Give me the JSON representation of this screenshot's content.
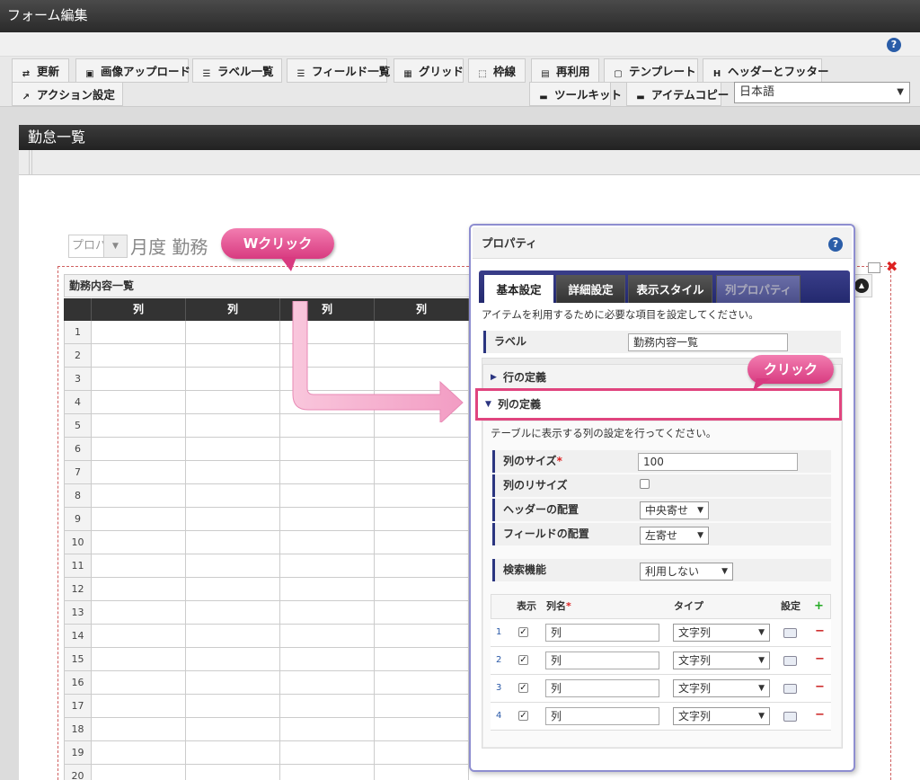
{
  "window": {
    "title": "フォーム編集"
  },
  "help_label": "?",
  "toolbar": {
    "row1": [
      {
        "label": "更新",
        "icon": "refresh-icon"
      },
      {
        "label": "画像アップロード",
        "icon": "image-upload-icon"
      },
      {
        "label": "ラベル一覧",
        "icon": "label-list-icon"
      },
      {
        "label": "フィールド一覧",
        "icon": "field-list-icon"
      },
      {
        "label": "グリッド",
        "icon": "grid-icon"
      },
      {
        "label": "枠線",
        "icon": "border-icon"
      },
      {
        "label": "再利用",
        "icon": "reuse-icon"
      },
      {
        "label": "テンプレート",
        "icon": "template-icon"
      },
      {
        "label": "ヘッダーとフッター",
        "icon": "header-footer-icon"
      }
    ],
    "row2": [
      {
        "label": "アクション設定",
        "icon": "action-icon"
      },
      {
        "label": "ツールキット",
        "icon": "toolkit-icon"
      },
      {
        "label": "アイテムコピー",
        "icon": "item-copy-icon"
      }
    ],
    "language": "日本語"
  },
  "form": {
    "title": "勤怠一覧",
    "month_select_placeholder": "プロパ",
    "month_text": "月度 勤務"
  },
  "table": {
    "title": "勤務内容一覧",
    "columns": [
      "列",
      "列",
      "列",
      "列"
    ],
    "row_numbers": [
      "1",
      "2",
      "3",
      "4",
      "5",
      "6",
      "7",
      "8",
      "9",
      "10",
      "11",
      "12",
      "13",
      "14",
      "15",
      "16",
      "17",
      "18",
      "19",
      "20"
    ]
  },
  "annotations": {
    "double_click": "Wクリック",
    "click": "クリック"
  },
  "properties": {
    "title": "プロパティ",
    "tabs": [
      {
        "label": "基本設定",
        "state": "active"
      },
      {
        "label": "詳細設定",
        "state": "normal"
      },
      {
        "label": "表示スタイル",
        "state": "normal"
      },
      {
        "label": "列プロパティ",
        "state": "disabled"
      }
    ],
    "description": "アイテムを利用するために必要な項目を設定してください。",
    "label_field": {
      "label": "ラベル",
      "value": "勤務内容一覧"
    },
    "row_section": "行の定義",
    "col_section": "列の定義",
    "col_description": "テーブルに表示する列の設定を行ってください。",
    "col_size": {
      "label": "列のサイズ",
      "required_mark": "*",
      "value": "100"
    },
    "col_resize": {
      "label": "列のリサイズ",
      "checked": false
    },
    "header_align": {
      "label": "ヘッダーの配置",
      "value": "中央寄せ"
    },
    "field_align": {
      "label": "フィールドの配置",
      "value": "左寄せ"
    },
    "search": {
      "label": "検索機能",
      "value": "利用しない"
    },
    "column_table": {
      "headers": {
        "show": "表示",
        "name": "列名",
        "name_required": "*",
        "type": "タイプ",
        "settings": "設定",
        "add": "+"
      },
      "rows": [
        {
          "index": "1",
          "checked": true,
          "name": "列",
          "type": "文字列"
        },
        {
          "index": "2",
          "checked": true,
          "name": "列",
          "type": "文字列"
        },
        {
          "index": "3",
          "checked": true,
          "name": "列",
          "type": "文字列"
        },
        {
          "index": "4",
          "checked": true,
          "name": "列",
          "type": "文字列"
        }
      ],
      "remove": "−"
    }
  },
  "colors": {
    "accent_pink": "#e0447e",
    "navy": "#2b3580",
    "help_blue": "#2a5da8"
  }
}
